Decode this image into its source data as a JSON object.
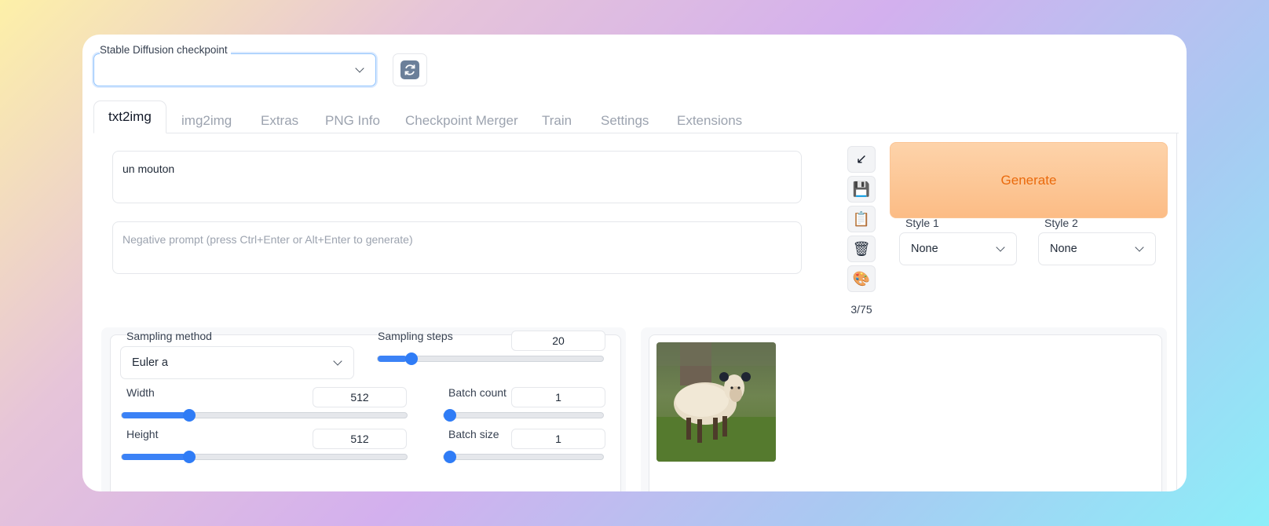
{
  "checkpoint": {
    "label": "Stable Diffusion checkpoint",
    "value": "",
    "refresh_icon": "refresh-icon"
  },
  "tabs": [
    {
      "label": "txt2img",
      "active": true
    },
    {
      "label": "img2img",
      "active": false
    },
    {
      "label": "Extras",
      "active": false
    },
    {
      "label": "PNG Info",
      "active": false
    },
    {
      "label": "Checkpoint Merger",
      "active": false
    },
    {
      "label": "Train",
      "active": false
    },
    {
      "label": "Settings",
      "active": false
    },
    {
      "label": "Extensions",
      "active": false
    }
  ],
  "prompt": {
    "value": "un mouton",
    "negative_placeholder": "Negative prompt (press Ctrl+Enter or Alt+Enter to generate)"
  },
  "tools": {
    "icons": [
      "arrow-down-left-icon",
      "save-icon",
      "clipboard-icon",
      "trash-icon",
      "palette-icon"
    ],
    "arrow": "↙",
    "save": "💾",
    "clipboard": "📋",
    "trash": "🗑",
    "palette": "🎨",
    "token_count": "3/75"
  },
  "generate": {
    "label": "Generate",
    "color": "#ea6a0c"
  },
  "styles": {
    "style1": {
      "label": "Style 1",
      "value": "None"
    },
    "style2": {
      "label": "Style 2",
      "value": "None"
    }
  },
  "settings": {
    "sampling_method": {
      "label": "Sampling method",
      "value": "Euler a"
    },
    "sampling_steps": {
      "label": "Sampling steps",
      "value": "20",
      "min": 1,
      "max": 150
    },
    "width": {
      "label": "Width",
      "value": "512",
      "min": 64,
      "max": 2048
    },
    "height": {
      "label": "Height",
      "value": "512",
      "min": 64,
      "max": 2048
    },
    "batch_count": {
      "label": "Batch count",
      "value": "1",
      "min": 1,
      "max": 100
    },
    "batch_size": {
      "label": "Batch size",
      "value": "1",
      "min": 1,
      "max": 8
    }
  },
  "colors": {
    "accent": "#2f7cf6",
    "generate_start": "#fdd3aa",
    "generate_end": "#fcbc85"
  }
}
